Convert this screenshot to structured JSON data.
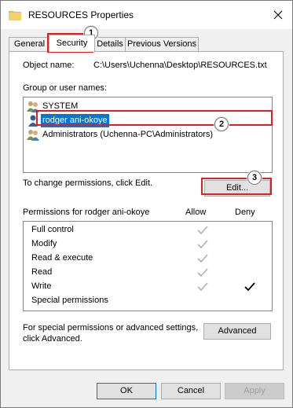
{
  "window": {
    "title": "RESOURCES Properties"
  },
  "tabs": [
    "General",
    "Security",
    "Details",
    "Previous Versions"
  ],
  "security": {
    "object_name_label": "Object name:",
    "object_name_value": "C:\\Users\\Uchenna\\Desktop\\RESOURCES.txt",
    "group_label": "Group or user names:",
    "users": [
      {
        "name": "SYSTEM",
        "icon": "users-group-icon"
      },
      {
        "name": "rodger ani-okoye",
        "icon": "user-icon",
        "selected": true
      },
      {
        "name": "Administrators (Uchenna-PC\\Administrators)",
        "icon": "users-group-icon"
      }
    ],
    "change_text": "To change permissions, click Edit.",
    "edit_label": "Edit...",
    "permissions_label": "Permissions for rodger ani-okoye",
    "allow_header": "Allow",
    "deny_header": "Deny",
    "permissions": [
      {
        "name": "Full control",
        "allow": "gray",
        "deny": ""
      },
      {
        "name": "Modify",
        "allow": "gray",
        "deny": ""
      },
      {
        "name": "Read & execute",
        "allow": "gray",
        "deny": ""
      },
      {
        "name": "Read",
        "allow": "gray",
        "deny": ""
      },
      {
        "name": "Write",
        "allow": "gray",
        "deny": "black"
      },
      {
        "name": "Special permissions",
        "allow": "",
        "deny": ""
      }
    ],
    "advanced_text_line1": "For special permissions or advanced settings,",
    "advanced_text_line2": "click Advanced.",
    "advanced_label": "Advanced"
  },
  "footer": {
    "ok": "OK",
    "cancel": "Cancel",
    "apply": "Apply"
  },
  "annotations": {
    "badge1": "1",
    "badge2": "2",
    "badge3": "3",
    "color": "#e02020"
  }
}
